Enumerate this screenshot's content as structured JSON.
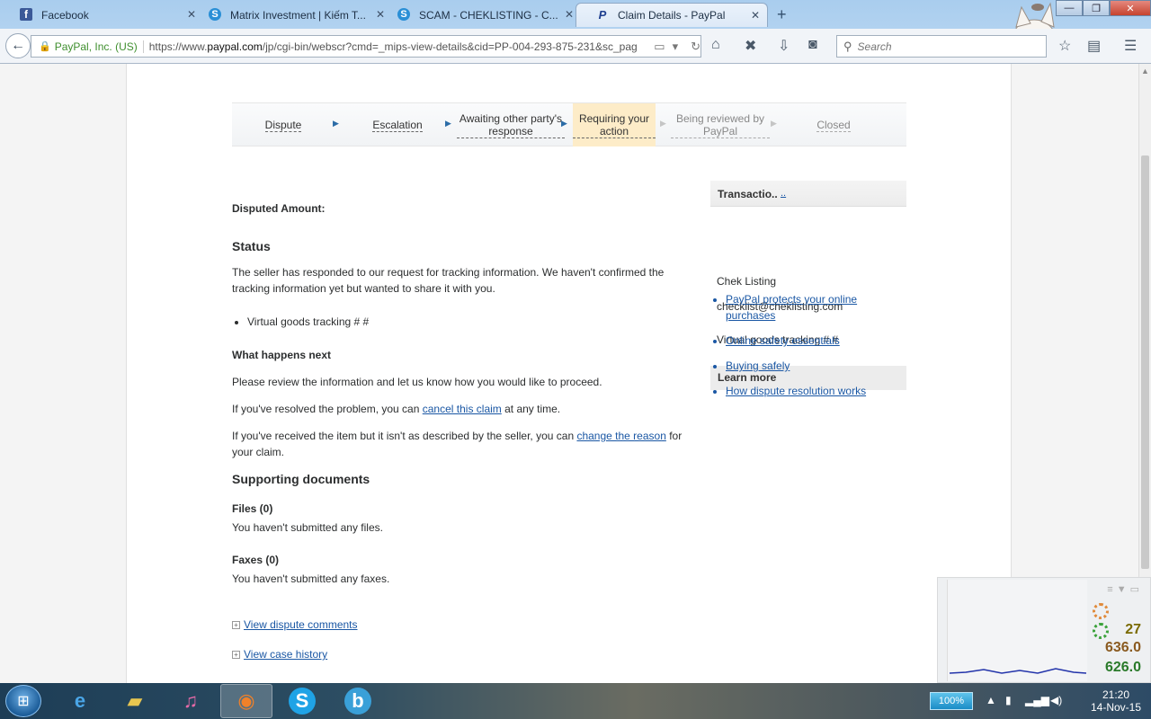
{
  "browser": {
    "tabs": [
      {
        "title": "Facebook",
        "favicon_color": "#3b5998",
        "favicon_letter": "f",
        "active": false
      },
      {
        "title": "Matrix Investment | Kiếm T...",
        "favicon_color": "#2a8fd6",
        "favicon_letter": "S",
        "active": false
      },
      {
        "title": "SCAM - CHEKLISTING - C...",
        "favicon_color": "#2a8fd6",
        "favicon_letter": "S",
        "active": false
      },
      {
        "title": "Claim Details - PayPal",
        "favicon_color": "#ffffff",
        "favicon_letter": "P",
        "active": true
      }
    ],
    "new_tab": "+",
    "window_controls": {
      "minimize": "—",
      "maximize": "❐",
      "close": "✕"
    },
    "site_identity": "PayPal, Inc. (US)",
    "url_prefix": "https://www.",
    "url_domain": "paypal.com",
    "url_rest": "/jp/cgi-bin/webscr?cmd=_mips-view-details&cid=PP-004-293-875-231&sc_pag",
    "search_placeholder": "Search"
  },
  "progress_steps": [
    {
      "label": "Dispute",
      "state": "done"
    },
    {
      "label": "Escalation",
      "state": "done"
    },
    {
      "label": "Awaiting other party's response",
      "state": "done"
    },
    {
      "label": "Requiring your action",
      "state": "current"
    },
    {
      "label": "Being reviewed by PayPal",
      "state": "future"
    },
    {
      "label": "Closed",
      "state": "future"
    }
  ],
  "main": {
    "disputed_amount_label": "Disputed Amount:",
    "status_heading": "Status",
    "status_text": "The seller has responded to our request for tracking information. We haven't confirmed the tracking information yet but wanted to share it with you.",
    "tracking_item": "Virtual goods tracking # #",
    "next_heading": "What happens next",
    "next_text": "Please review the information and let us know how you would like to proceed.",
    "resolved_before": "If you've resolved the problem, you can ",
    "resolved_link": "cancel this claim",
    "resolved_after": " at any time.",
    "received_before": "If you've received the item but it isn't as described by the seller, you can ",
    "received_link": "change the reason",
    "received_after": " for your claim.",
    "supporting_heading": "Supporting documents",
    "files_label": "Files (0)",
    "files_text": "You haven't submitted any files.",
    "faxes_label": "Faxes (0)",
    "faxes_text": "You haven't submitted any faxes.",
    "view_comments": "View dispute comments",
    "view_history": "View case history"
  },
  "sidebar": {
    "transaction_label": "Transactio..",
    "transaction_link": "..",
    "seller_name": "Chek Listing",
    "seller_email": "checklist@cheklisting.com",
    "seller_tracking": "Virtual goods tracking # #",
    "learn_more_title": "Learn more",
    "learn_more_links": [
      "PayPal protects your online purchases",
      "Online safety essentials",
      "Buying safely",
      "How dispute resolution works"
    ]
  },
  "widget": {
    "value1": "27",
    "value2": "636.0",
    "value3": "626.0"
  },
  "taskbar": {
    "battery": "100%",
    "time": "21:20",
    "date": "14-Nov-15"
  }
}
